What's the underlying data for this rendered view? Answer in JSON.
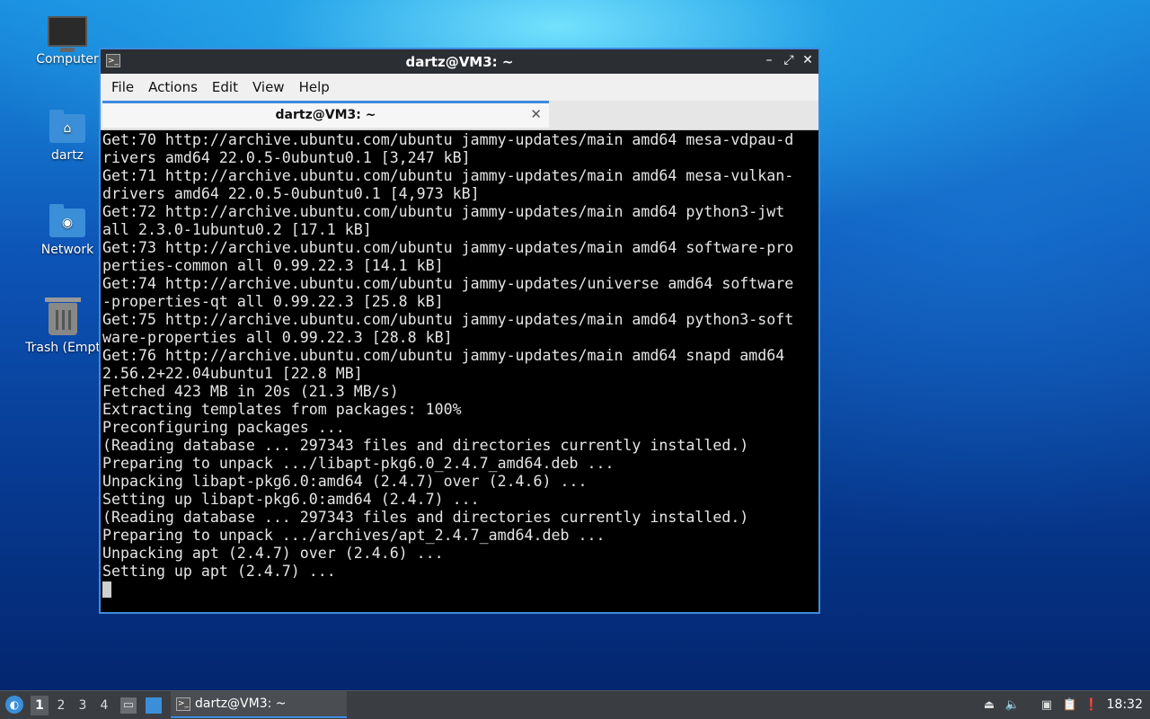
{
  "desktop": {
    "icons": [
      {
        "label": "Computer",
        "icon": "computer-icon"
      },
      {
        "label": "dartz",
        "icon": "home-folder-icon"
      },
      {
        "label": "Network",
        "icon": "network-folder-icon"
      },
      {
        "label": "Trash (Empt",
        "icon": "trash-icon"
      }
    ]
  },
  "window": {
    "title": "dartz@VM3: ~",
    "app_icon": ">_",
    "controls": {
      "minimize": "–",
      "maximize": "⤢",
      "close": "✕"
    },
    "menu": [
      "File",
      "Actions",
      "Edit",
      "View",
      "Help"
    ],
    "tab": {
      "label": "dartz@VM3: ~",
      "close": "✕"
    },
    "terminal_lines": [
      "Get:70 http://archive.ubuntu.com/ubuntu jammy-updates/main amd64 mesa-vdpau-d",
      "rivers amd64 22.0.5-0ubuntu0.1 [3,247 kB]",
      "Get:71 http://archive.ubuntu.com/ubuntu jammy-updates/main amd64 mesa-vulkan-",
      "drivers amd64 22.0.5-0ubuntu0.1 [4,973 kB]",
      "Get:72 http://archive.ubuntu.com/ubuntu jammy-updates/main amd64 python3-jwt",
      "all 2.3.0-1ubuntu0.2 [17.1 kB]",
      "Get:73 http://archive.ubuntu.com/ubuntu jammy-updates/main amd64 software-pro",
      "perties-common all 0.99.22.3 [14.1 kB]",
      "Get:74 http://archive.ubuntu.com/ubuntu jammy-updates/universe amd64 software",
      "-properties-qt all 0.99.22.3 [25.8 kB]",
      "Get:75 http://archive.ubuntu.com/ubuntu jammy-updates/main amd64 python3-soft",
      "ware-properties all 0.99.22.3 [28.8 kB]",
      "Get:76 http://archive.ubuntu.com/ubuntu jammy-updates/main amd64 snapd amd64",
      "2.56.2+22.04ubuntu1 [22.8 MB]",
      "Fetched 423 MB in 20s (21.3 MB/s)",
      "Extracting templates from packages: 100%",
      "Preconfiguring packages ...",
      "(Reading database ... 297343 files and directories currently installed.)",
      "Preparing to unpack .../libapt-pkg6.0_2.4.7_amd64.deb ...",
      "Unpacking libapt-pkg6.0:amd64 (2.4.7) over (2.4.6) ...",
      "Setting up libapt-pkg6.0:amd64 (2.4.7) ...",
      "(Reading database ... 297343 files and directories currently installed.)",
      "Preparing to unpack .../archives/apt_2.4.7_amd64.deb ...",
      "Unpacking apt (2.4.7) over (2.4.6) ...",
      "Setting up apt (2.4.7) ..."
    ]
  },
  "taskbar": {
    "workspaces": [
      "1",
      "2",
      "3",
      "4"
    ],
    "active_workspace": "1",
    "task_label": "dartz@VM3: ~",
    "clock": "18:32",
    "tray_icons": [
      "eject-icon",
      "volume-icon",
      "network-icon",
      "clipboard-icon",
      "update-icon"
    ]
  }
}
